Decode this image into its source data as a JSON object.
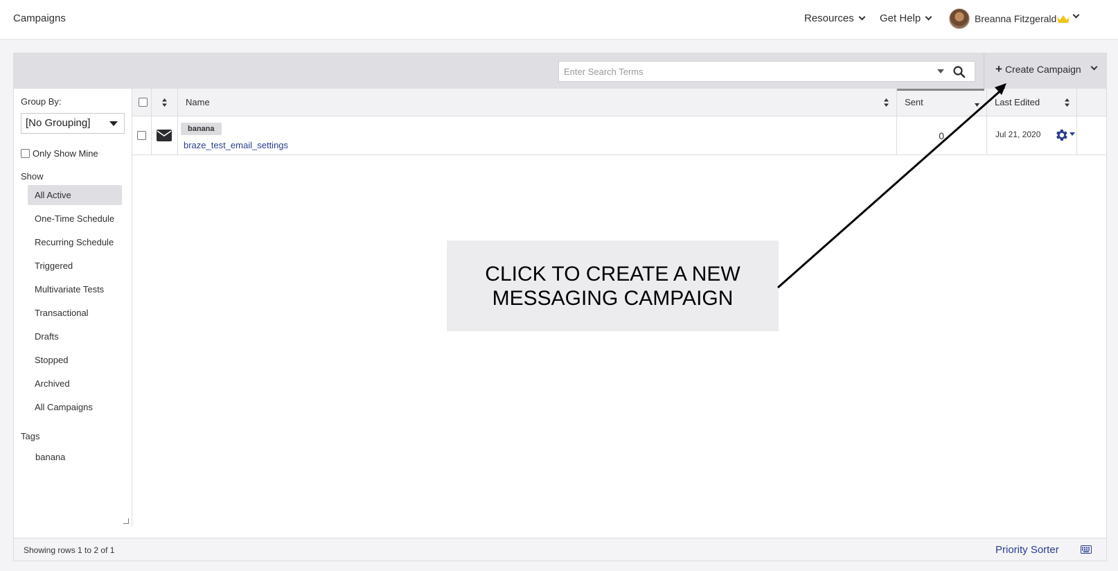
{
  "header": {
    "page_title": "Campaigns",
    "nav": [
      {
        "label": "Resources"
      },
      {
        "label": "Get Help"
      }
    ],
    "user_name": "Breanna Fitzgerald"
  },
  "toolbar": {
    "search_placeholder": "Enter Search Terms",
    "create_label": "Create Campaign"
  },
  "sidebar": {
    "group_by_label": "Group By:",
    "group_by_value": "[No Grouping]",
    "only_show_mine": "Only Show Mine",
    "show_label": "Show",
    "show_items": [
      {
        "label": "All Active"
      },
      {
        "label": "One-Time Schedule"
      },
      {
        "label": "Recurring Schedule"
      },
      {
        "label": "Triggered"
      },
      {
        "label": "Multivariate Tests"
      },
      {
        "label": "Transactional"
      },
      {
        "label": "Drafts"
      },
      {
        "label": "Stopped"
      },
      {
        "label": "Archived"
      },
      {
        "label": "All Campaigns"
      }
    ],
    "tags_label": "Tags",
    "tags": [
      "banana"
    ]
  },
  "table": {
    "columns": {
      "name": "Name",
      "sent": "Sent",
      "last_edited": "Last Edited"
    },
    "rows": [
      {
        "tag": "banana",
        "name": "braze_test_email_settings",
        "sent": "0",
        "last_edited": "Jul 21, 2020"
      }
    ]
  },
  "callout": {
    "text": "CLICK TO CREATE A NEW MESSAGING CAMPAIGN"
  },
  "footer": {
    "rows_text": "Showing rows 1 to 2 of 1",
    "priority_sorter": "Priority Sorter"
  },
  "colors": {
    "link": "#2a3d8f",
    "toolbar_bg": "#dfdfe3",
    "crown": "#f2c318"
  }
}
